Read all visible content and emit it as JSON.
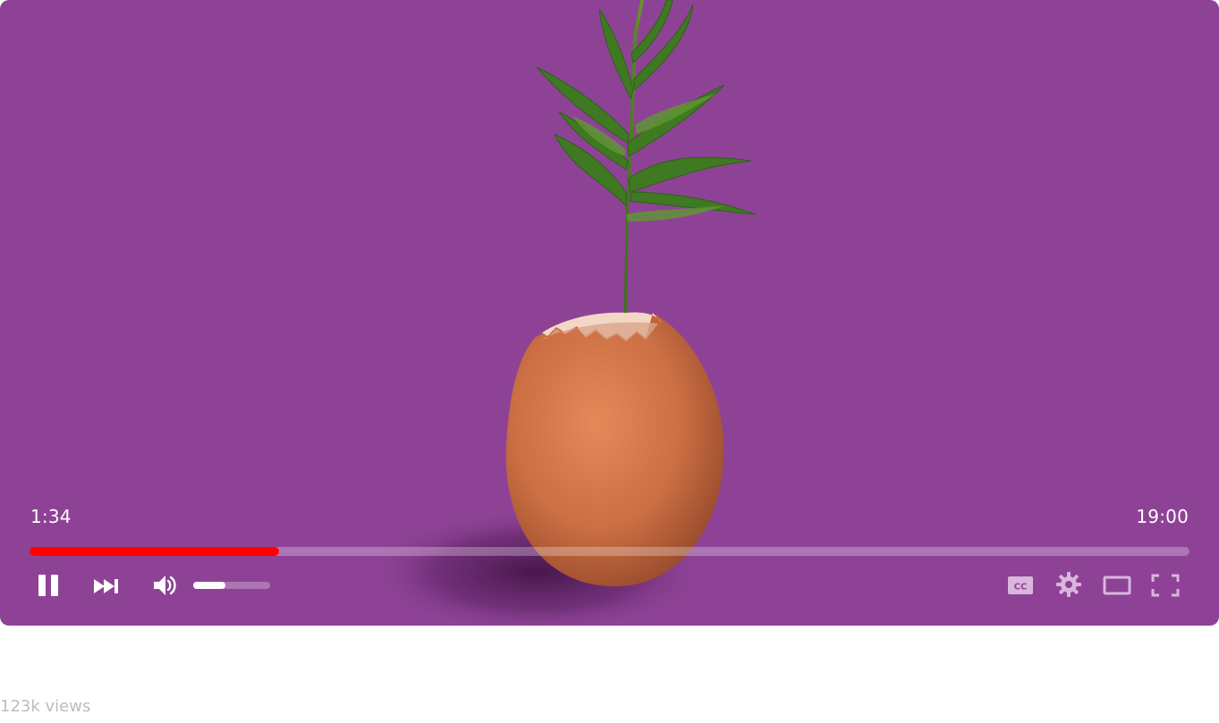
{
  "player": {
    "current_time": "1:34",
    "duration": "19:00",
    "progress_fraction": 0.215,
    "volume_fraction": 0.42,
    "state": "playing",
    "colors": {
      "background": "#8e4296",
      "progress": "#ff0000",
      "controls": "#ffffff"
    },
    "controls": {
      "left": [
        "pause-icon",
        "skip-next-icon",
        "volume-icon"
      ],
      "right": [
        "closed-captions-icon",
        "settings-gear-icon",
        "theater-mode-icon",
        "fullscreen-icon"
      ]
    },
    "cc_label": "CC"
  },
  "views_label": "123k views"
}
